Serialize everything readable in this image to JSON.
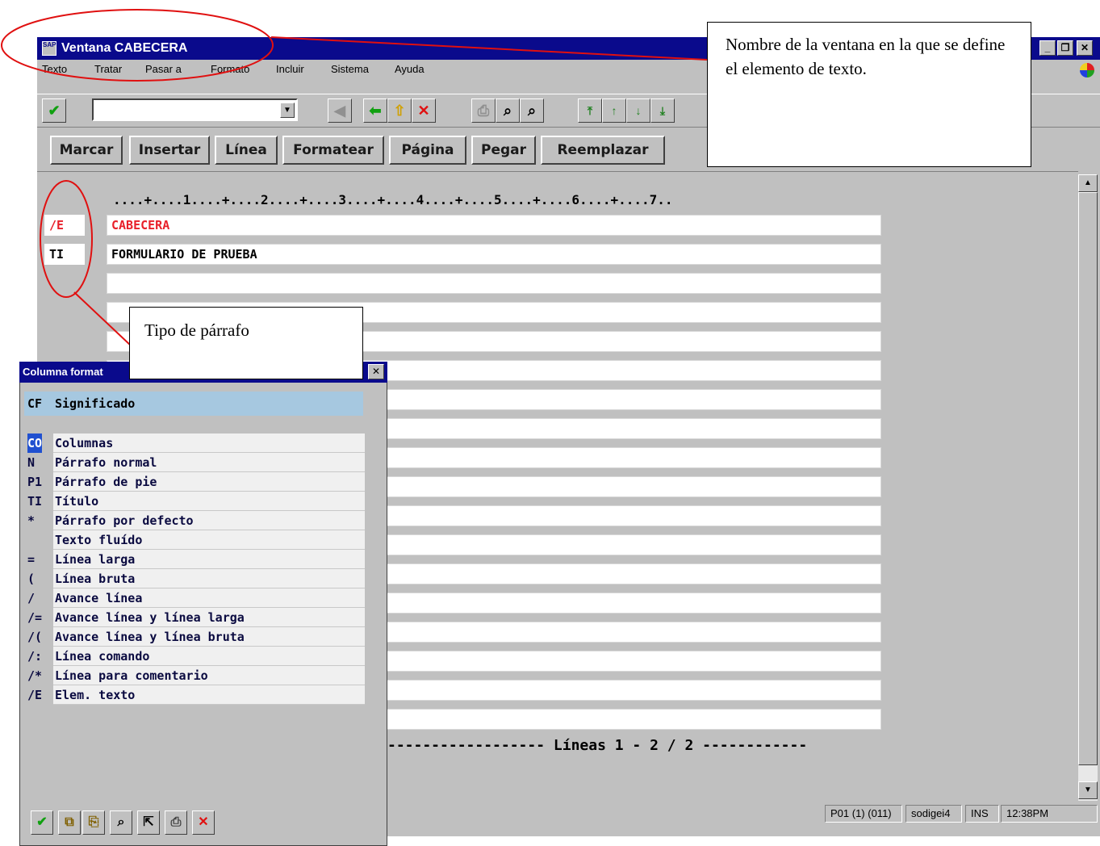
{
  "window": {
    "title": "Ventana CABECERA",
    "icon_label": "SAP",
    "controls": [
      "_",
      "❐",
      "✕"
    ]
  },
  "menu": [
    {
      "label": "Texto"
    },
    {
      "label": "Tratar"
    },
    {
      "label": "Pasar a"
    },
    {
      "label": "Formato"
    },
    {
      "label": "Incluir"
    },
    {
      "label": "Sistema"
    },
    {
      "label": "Ayuda"
    }
  ],
  "toolbar": {
    "command_value": "",
    "icons": [
      "check-icon",
      "save-icon",
      "back-icon",
      "exit-icon",
      "cancel-icon",
      "print-icon",
      "find-icon",
      "find-next-icon",
      "first-page-icon",
      "previous-page-icon",
      "next-page-icon",
      "last-page-icon"
    ]
  },
  "app_buttons": [
    "Marcar",
    "Insertar",
    "Línea",
    "Formatear",
    "Página",
    "Pegar",
    "Reemplazar"
  ],
  "editor": {
    "ruler": "....+....1....+....2....+....3....+....4....+....5....+....6....+....7..",
    "lines": [
      {
        "format": "/E",
        "text": "CABECERA"
      },
      {
        "format": "TI",
        "text": "FORMULARIO DE PRUEBA"
      }
    ],
    "lines_counter": "------------------ Líneas 1 - 2 / 2 ------------",
    "colors": {
      "element_text": "#e8202a",
      "title_bar": "#0a0a8c",
      "popup_header": "#a6c8e0"
    }
  },
  "status": {
    "system": "P01 (1) (011)",
    "host": "sodigei4",
    "mode": "INS",
    "time": "12:38PM"
  },
  "popup": {
    "title": "Columna format",
    "close": "✕",
    "header_code": "CF",
    "header_meaning": "Significado",
    "rows": [
      {
        "code": "CO",
        "meaning": "Columnas"
      },
      {
        "code": "N",
        "meaning": "Párrafo normal"
      },
      {
        "code": "P1",
        "meaning": "Párrafo de pie"
      },
      {
        "code": "TI",
        "meaning": "Título"
      },
      {
        "code": "*",
        "meaning": "Párrafo por defecto"
      },
      {
        "code": "",
        "meaning": "Texto fluído"
      },
      {
        "code": "=",
        "meaning": "Línea larga"
      },
      {
        "code": "(",
        "meaning": "Línea bruta"
      },
      {
        "code": "/",
        "meaning": "Avance línea"
      },
      {
        "code": "/=",
        "meaning": "Avance línea y línea larga"
      },
      {
        "code": "/(",
        "meaning": "Avance línea y línea bruta"
      },
      {
        "code": "/:",
        "meaning": "Línea comando"
      },
      {
        "code": "/*",
        "meaning": "Línea para comentario"
      },
      {
        "code": "/E",
        "meaning": "Elem. texto"
      }
    ],
    "buttons": [
      "confirm-icon",
      "copy-icon",
      "paste-icon",
      "find-icon",
      "export-icon",
      "print-icon",
      "cancel-icon"
    ]
  },
  "callouts": {
    "window_name": "Nombre de la ventana en la que se define el elemento de texto.",
    "paragraph_type": "Tipo de párrafo"
  }
}
